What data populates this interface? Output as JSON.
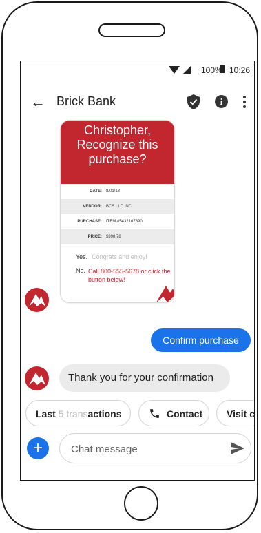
{
  "status": {
    "battery": "100%",
    "time": "10:26"
  },
  "appbar": {
    "title": "Brick Bank"
  },
  "card": {
    "heading": [
      "Christopher,",
      "Recognize this",
      "purchase?"
    ],
    "rows": [
      {
        "label": "DATE:",
        "value": "8/01/18"
      },
      {
        "label": "VENDOR:",
        "value": "BCS LLC INC"
      },
      {
        "label": "PURCHASE:",
        "value": "ITEM #5432167890"
      },
      {
        "label": "PRICE:",
        "value": "$998.78"
      }
    ],
    "yes_label": "Yes.",
    "yes_text": "Congrats and enjoy!",
    "no_label": "No.",
    "no_text": "Call 800-555-5678 or click the button below!"
  },
  "messages": {
    "outgoing": "Confirm purchase",
    "incoming": "Thank you for your confirmation"
  },
  "chips": {
    "last_a": "Last",
    "last_b": "5 trans",
    "last_c": "actions",
    "contact": "Contact",
    "visit": "Visit clo"
  },
  "compose": {
    "placeholder": "Chat message",
    "add": "+"
  },
  "colors": {
    "brand_red": "#c2262f",
    "accent_blue": "#1a73e8"
  }
}
